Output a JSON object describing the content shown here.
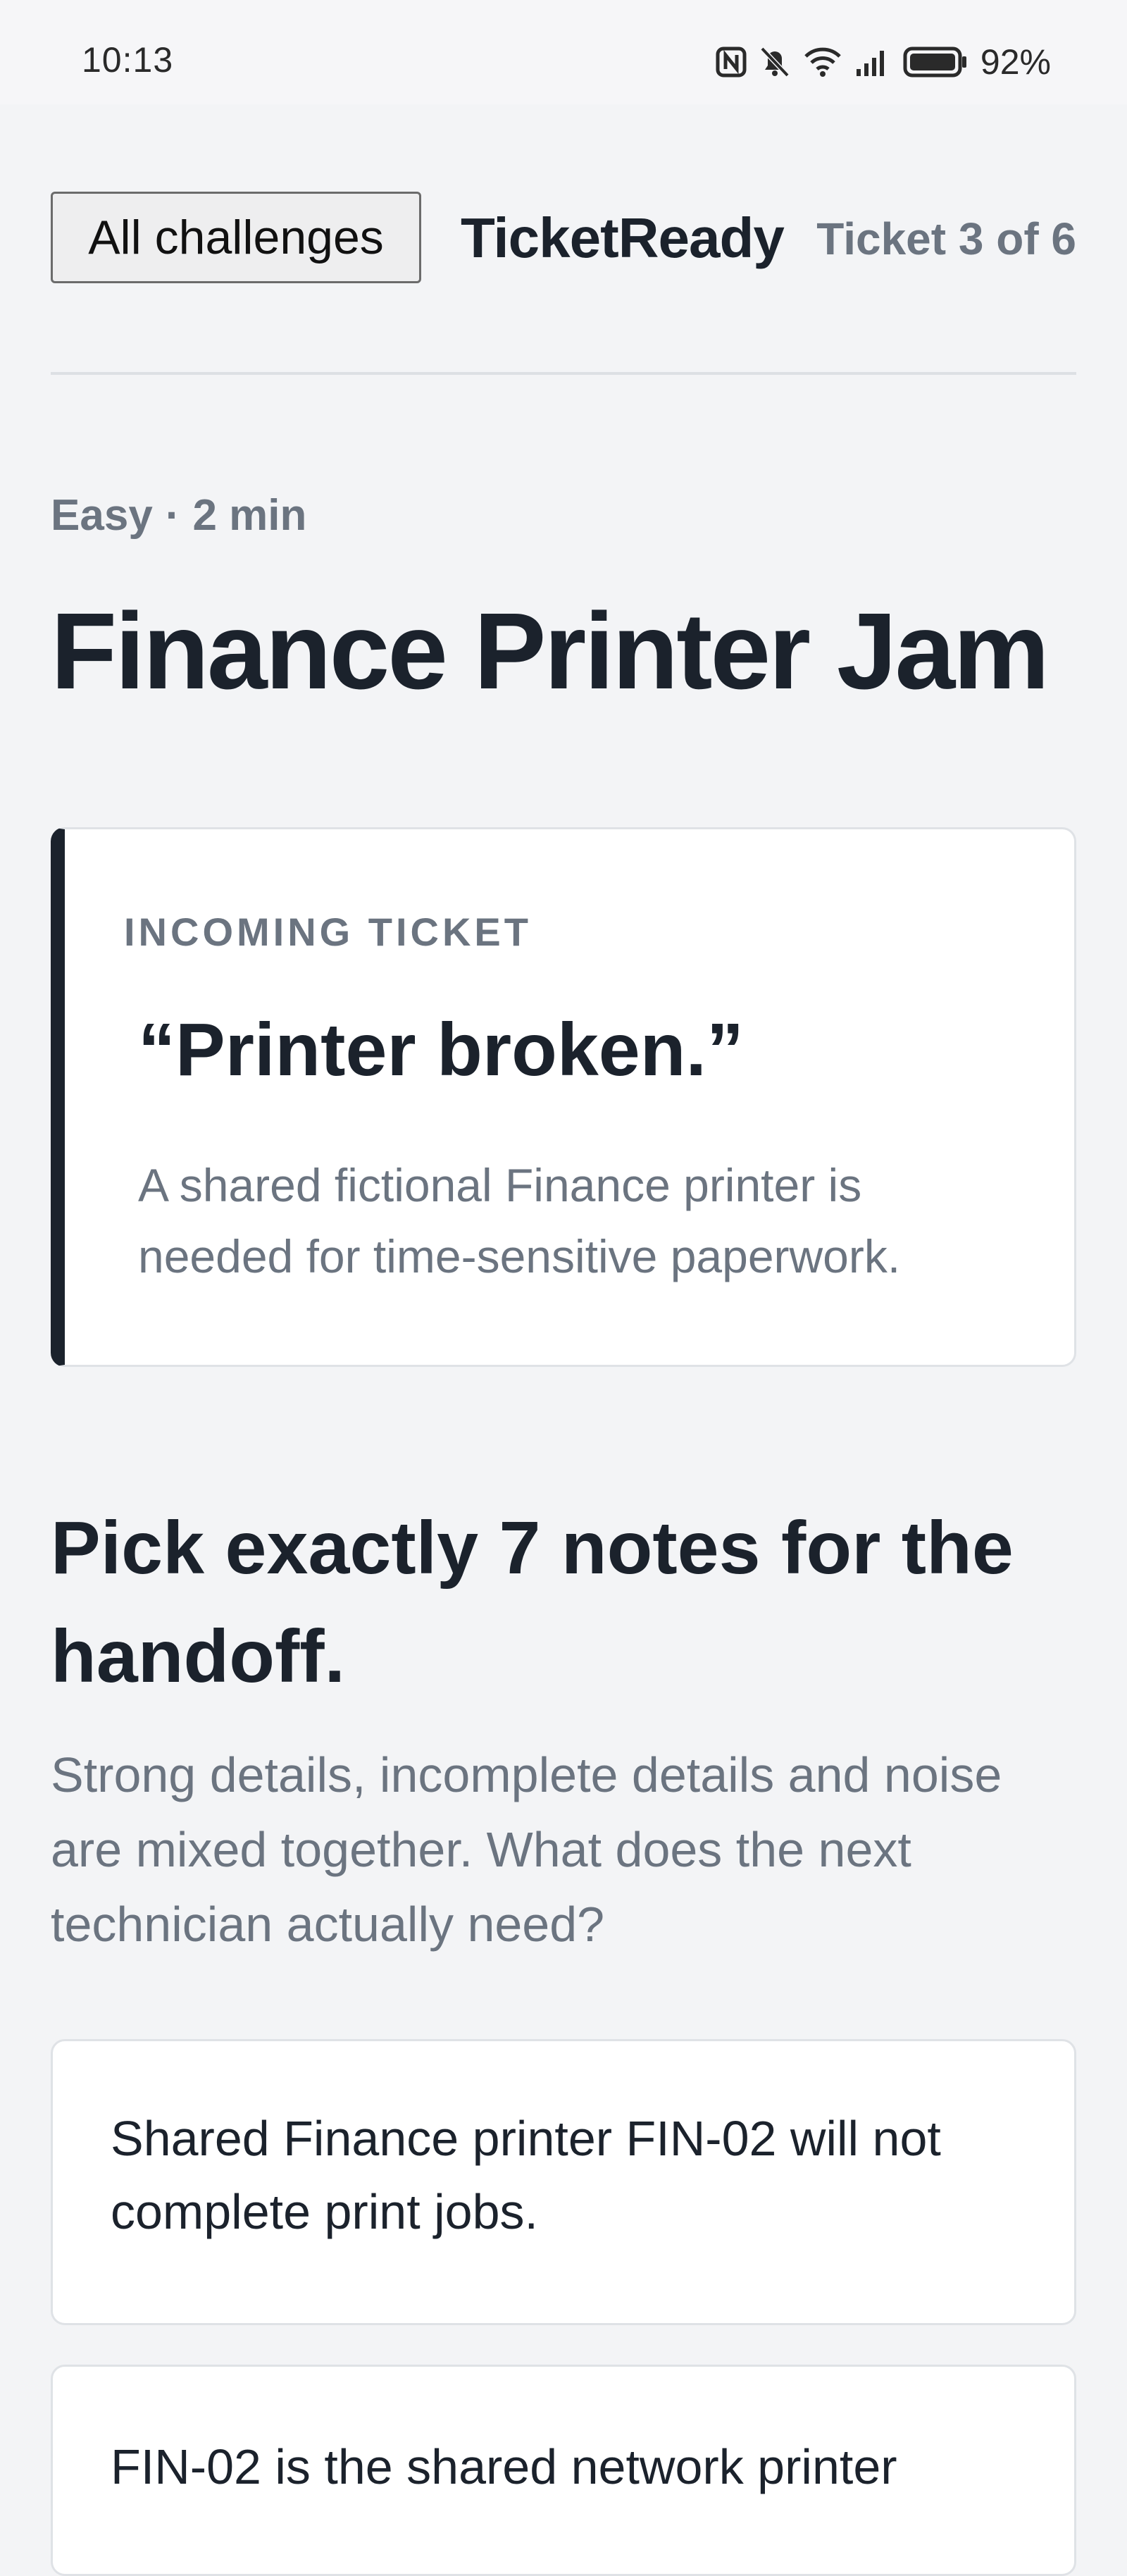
{
  "status_bar": {
    "time": "10:13",
    "battery": "92%",
    "icons": [
      "nfc-icon",
      "bell-off-icon",
      "wifi-icon",
      "signal-icon",
      "battery-icon"
    ]
  },
  "header": {
    "back_label": "All challenges",
    "brand": "TicketReady",
    "ticket_counter": "Ticket 3 of 6"
  },
  "challenge": {
    "difficulty": "Easy",
    "separator": "·",
    "duration": "2 min",
    "title": "Finance Printer Jam"
  },
  "ticket": {
    "label": "INCOMING TICKET",
    "quote": "“Printer broken.”",
    "description": "A shared fictional Finance printer is needed for time-sensitive paperwork."
  },
  "instructions": {
    "heading": "Pick exactly 7 notes for the handoff.",
    "description": "Strong details, incomplete details and noise are mixed together. What does the next technician actually need?"
  },
  "notes": [
    {
      "text": "Shared Finance printer FIN-02 will not complete print jobs."
    },
    {
      "text": "FIN-02 is the shared network printer"
    }
  ],
  "colors": {
    "background": "#f3f4f6",
    "text_primary": "#1b222c",
    "text_muted": "#6b7480",
    "card_border": "#dfe2e6",
    "accent_bar": "#1b222c"
  }
}
